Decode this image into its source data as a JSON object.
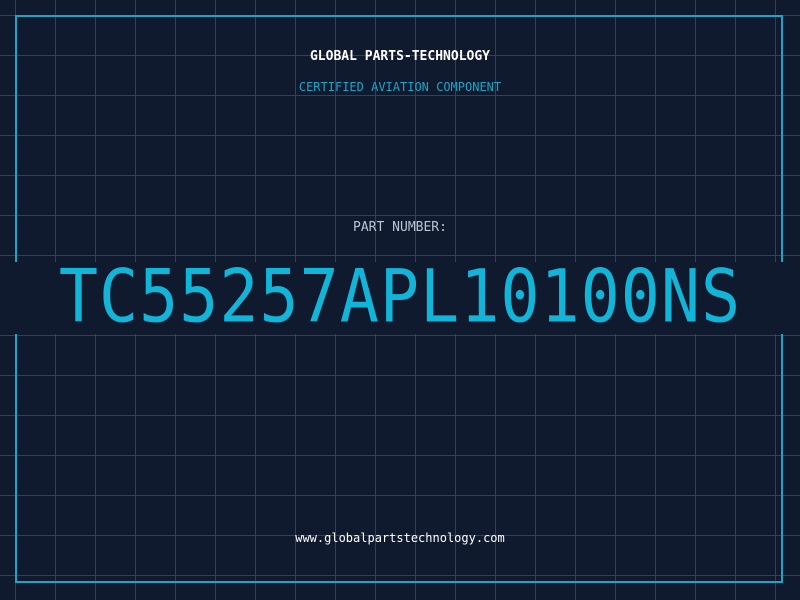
{
  "header": {
    "company": "GLOBAL PARTS-TECHNOLOGY",
    "subtitle": "CERTIFIED AVIATION COMPONENT"
  },
  "part": {
    "label": "PART NUMBER:",
    "number": "TC55257APL10100NS"
  },
  "footer": {
    "website": "www.globalpartstechnology.com"
  },
  "colors": {
    "background": "#0f1a2e",
    "grid": "#1c4a5e",
    "accent": "#1aa6c8",
    "part_number": "#12b4d8",
    "label": "#b8c6d6",
    "text": "#ffffff"
  }
}
